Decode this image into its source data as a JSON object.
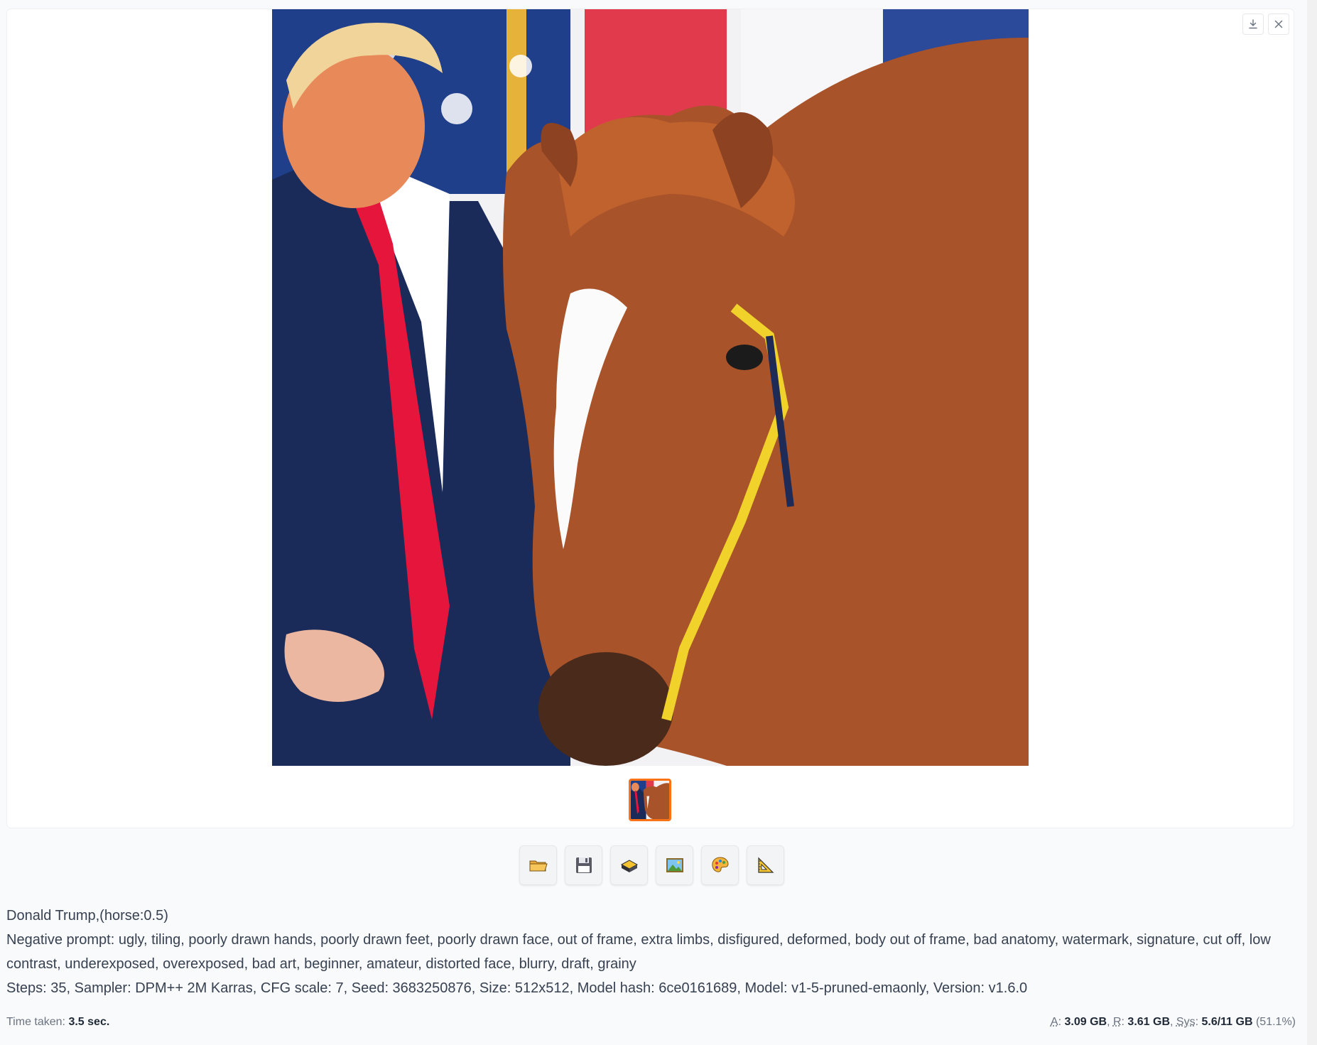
{
  "gallery": {
    "controls": [
      "download-icon",
      "close-icon"
    ]
  },
  "toolbar": {
    "buttons": [
      {
        "icon": "folder-icon",
        "label": "📂"
      },
      {
        "icon": "save-icon",
        "label": "💾"
      },
      {
        "icon": "zip-icon",
        "label": "🗜"
      },
      {
        "icon": "image-icon",
        "label": "🖼"
      },
      {
        "icon": "palette-icon",
        "label": "🎨"
      },
      {
        "icon": "triangle-ruler-icon",
        "label": "📐"
      }
    ]
  },
  "info": {
    "prompt": "Donald Trump,(horse:0.5)",
    "negative": "Negative prompt: ugly, tiling, poorly drawn hands, poorly drawn feet, poorly drawn face, out of frame, extra limbs, disfigured, deformed, body out of frame, bad anatomy, watermark, signature, cut off, low contrast, underexposed, overexposed, bad art, beginner, amateur, distorted face, blurry, draft, grainy",
    "params": "Steps: 35, Sampler: DPM++ 2M Karras, CFG scale: 7, Seed: 3683250876, Size: 512x512, Model hash: 6ce0161689, Model: v1-5-pruned-emaonly, Version: v1.6.0"
  },
  "footer": {
    "time_label": "Time taken:",
    "time_value": "3.5 sec.",
    "a_label": "A",
    "a_value": "3.09 GB",
    "r_label": "R",
    "r_value": "3.61 GB",
    "sys_label": "Sys",
    "sys_value": "5.6/11 GB",
    "sys_pct": "(51.1%)"
  },
  "colors": {
    "thumb_border": "#f97316",
    "bg": "#f9fafb"
  }
}
